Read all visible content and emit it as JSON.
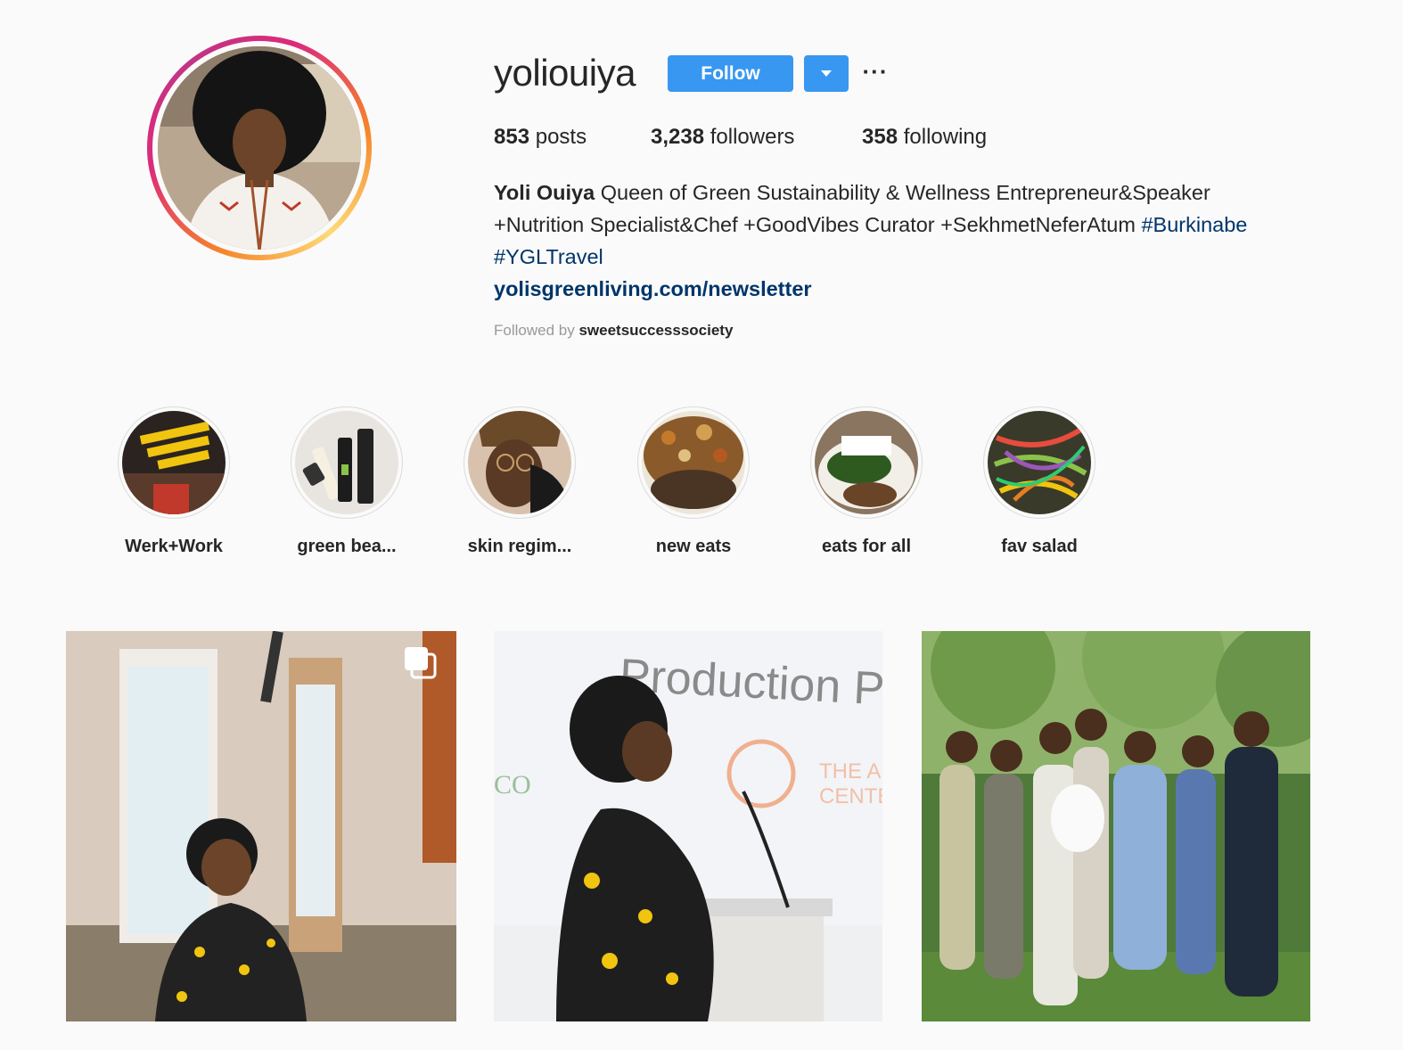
{
  "profile": {
    "username": "yoliouiya",
    "follow_label": "Follow",
    "more_label": "···",
    "stats": {
      "posts_count": "853",
      "posts_label": "posts",
      "followers_count": "3,238",
      "followers_label": "followers",
      "following_count": "358",
      "following_label": "following"
    },
    "bio": {
      "full_name": "Yoli Ouiya",
      "text_line1": "Queen of Green Sustainability & Wellness Entrepreneur&Speaker",
      "text_line2": "+Nutrition Specialist&Chef +GoodVibes Curator +SekhmetNeferAtum",
      "hashtag1": "#Burkinabe",
      "hashtag2": "#YGLTravel",
      "link": "yolisgreenliving.com/newsletter"
    },
    "followed_by_label": "Followed by",
    "followed_by_user": "sweetsuccesssociety"
  },
  "highlights": [
    {
      "label": "Werk+Work"
    },
    {
      "label": "green bea..."
    },
    {
      "label": "skin regim..."
    },
    {
      "label": "new eats"
    },
    {
      "label": "eats for all"
    },
    {
      "label": "fav salad"
    }
  ],
  "posts": [
    {
      "type": "carousel",
      "icon": "multiple-images-icon"
    },
    {
      "type": "photo",
      "sign_text": "Production P",
      "sign_text2": "THE A",
      "sign_text3": "CENTE",
      "sign_text4": "CO"
    },
    {
      "type": "photo"
    }
  ],
  "colors": {
    "accent": "#3897f0",
    "link": "#003569",
    "background": "#fafafa"
  }
}
